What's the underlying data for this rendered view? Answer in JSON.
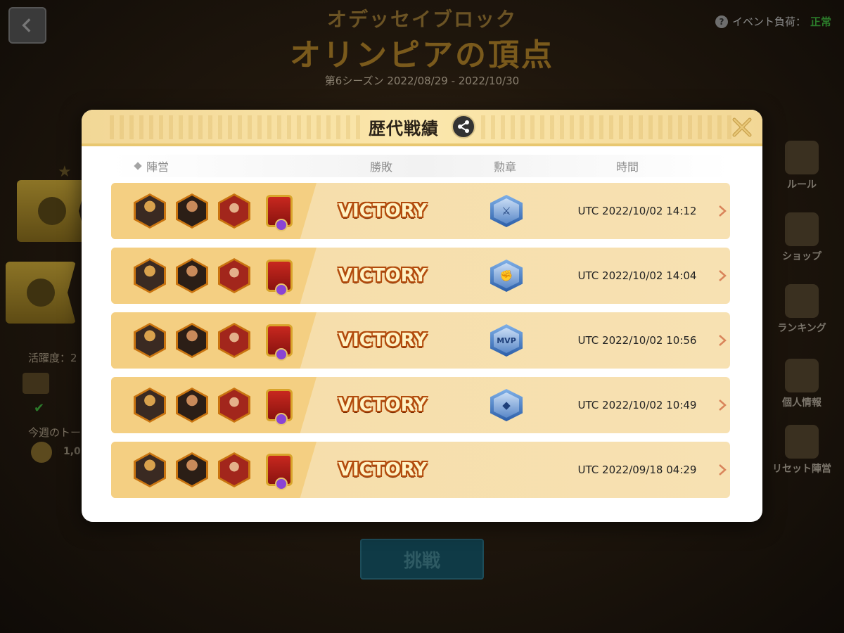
{
  "header": {
    "subtitle": "オデッセイブロック",
    "title": "オリンピアの頂点",
    "season": "第6シーズン 2022/08/29 - 2022/10/30",
    "event_status_label": "イベント負荷：",
    "event_status_value": "正常"
  },
  "left_panel": {
    "activity_label": "活躍度：2",
    "weekly_label": "今週のトー",
    "coin_value": "1,0"
  },
  "right_menu": [
    {
      "label": "ルール",
      "icon": "chest-icon"
    },
    {
      "label": "ショップ",
      "icon": "shop-cart-icon"
    },
    {
      "label": "ランキング",
      "icon": "trophy-icon"
    },
    {
      "label": "個人情報",
      "icon": "scroll-icon"
    },
    {
      "label": "リセット陣営",
      "icon": "warrior-icon"
    }
  ],
  "challenge_button": "挑戦",
  "modal": {
    "title": "歴代戦績",
    "columns": {
      "faction": "陣営",
      "result": "勝敗",
      "medal": "勲章",
      "time": "時間"
    },
    "records": [
      {
        "result": "VICTORY",
        "medal": "crossed-swords-medal-icon",
        "medal_text": "⚔",
        "time": "UTC 2022/10/02 14:12"
      },
      {
        "result": "VICTORY",
        "medal": "fist-medal-icon",
        "medal_text": "✊",
        "time": "UTC 2022/10/02 14:04"
      },
      {
        "result": "VICTORY",
        "medal": "mvp-medal-icon",
        "medal_text": "MVP",
        "time": "UTC 2022/10/02 10:56"
      },
      {
        "result": "VICTORY",
        "medal": "helmet-medal-icon",
        "medal_text": "◆",
        "time": "UTC 2022/10/02 10:49"
      },
      {
        "result": "VICTORY",
        "medal": "",
        "medal_text": "",
        "time": "UTC 2022/09/18 04:29"
      }
    ]
  },
  "colors": {
    "modal_header": "#f8e0a0",
    "row_bg": "#f7e1b2",
    "victory_fill": "#fff3c4",
    "victory_outline": "#b24b0c",
    "status_ok": "#2b7a2a"
  }
}
